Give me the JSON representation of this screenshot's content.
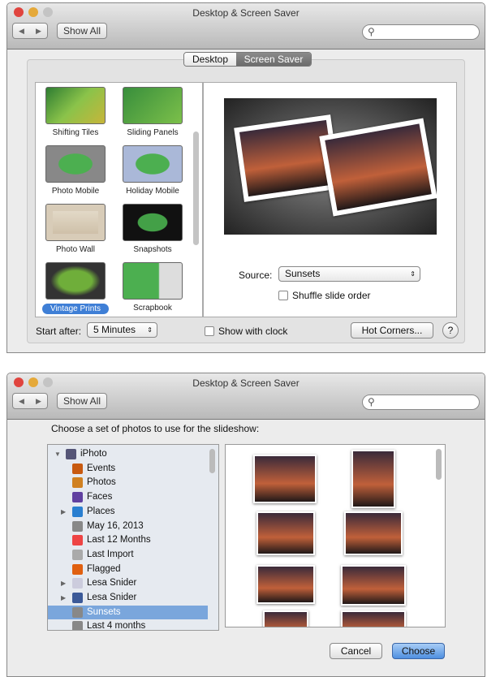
{
  "window_title": "Desktop & Screen Saver",
  "toolbar": {
    "show_all": "Show All",
    "back": "◀",
    "forward": "▶",
    "search_icon": "magnifier"
  },
  "tabs": [
    {
      "label": "Desktop",
      "selected": false
    },
    {
      "label": "Screen Saver",
      "selected": true
    }
  ],
  "screensavers": [
    {
      "label": "Shifting Tiles"
    },
    {
      "label": "Sliding Panels"
    },
    {
      "label": "Photo Mobile"
    },
    {
      "label": "Holiday Mobile"
    },
    {
      "label": "Photo Wall"
    },
    {
      "label": "Snapshots"
    },
    {
      "label": "Vintage Prints",
      "selected": true
    },
    {
      "label": "Scrapbook"
    }
  ],
  "options": {
    "source_label": "Source:",
    "source_value": "Sunsets",
    "shuffle_label": "Shuffle slide order",
    "shuffle_checked": false
  },
  "bottom": {
    "start_after_label": "Start after:",
    "start_after_value": "5 Minutes",
    "show_clock_label": "Show with clock",
    "hot_corners": "Hot Corners...",
    "help": "?"
  },
  "dialog": {
    "prompt": "Choose a set of photos to use for the slideshow:",
    "sources": [
      {
        "label": "iPhoto",
        "icon": "iphoto",
        "disclosure": "open",
        "level": 0
      },
      {
        "label": "Events",
        "icon": "events",
        "level": 1
      },
      {
        "label": "Photos",
        "icon": "photos",
        "level": 1
      },
      {
        "label": "Faces",
        "icon": "faces",
        "level": 1
      },
      {
        "label": "Places",
        "icon": "globe",
        "disclosure": "closed",
        "level": 1
      },
      {
        "label": "May 16, 2013",
        "icon": "album",
        "level": 1
      },
      {
        "label": "Last 12 Months",
        "icon": "calendar",
        "level": 1
      },
      {
        "label": "Last Import",
        "icon": "import",
        "level": 1
      },
      {
        "label": "Flagged",
        "icon": "flag",
        "level": 1
      },
      {
        "label": "Lesa Snider",
        "icon": "flickr",
        "disclosure": "closed",
        "level": 1
      },
      {
        "label": "Lesa Snider",
        "icon": "facebook",
        "disclosure": "closed",
        "level": 1
      },
      {
        "label": "Sunsets",
        "icon": "album",
        "level": 1,
        "selected": true
      },
      {
        "label": "Last 4 months",
        "icon": "album",
        "level": 1
      }
    ],
    "cancel": "Cancel",
    "choose": "Choose"
  },
  "colors": {
    "selection": "#3f7fd6",
    "source_selected": "#7aa6dc",
    "default_button": "#6aa3ea"
  }
}
